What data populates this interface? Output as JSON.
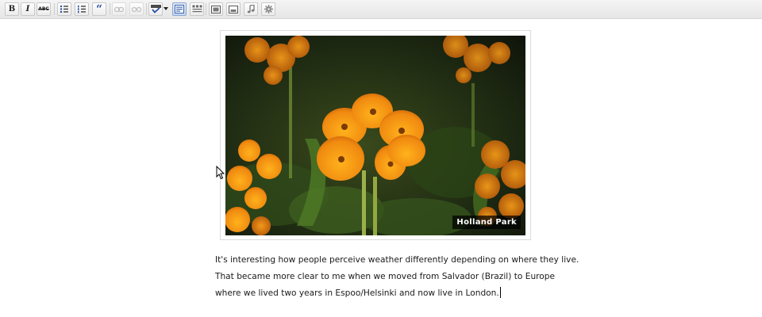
{
  "toolbar": {
    "bold_label": "B",
    "italic_label": "I",
    "strikethrough_label": "ABC",
    "blockquote_label": "“"
  },
  "image": {
    "caption": "Holland Park"
  },
  "content": {
    "lines": [
      "It's interesting how people perceive weather differently depending on where they live.",
      "That became more clear to me when we moved from Salvador (Brazil) to Europe",
      "where we lived two years in Espoo/Helsinki and now live in London."
    ]
  },
  "colors": {
    "toolbar_bg": "#eaeaea",
    "flower_orange": "#f08a10",
    "caption_bg": "#000000"
  }
}
